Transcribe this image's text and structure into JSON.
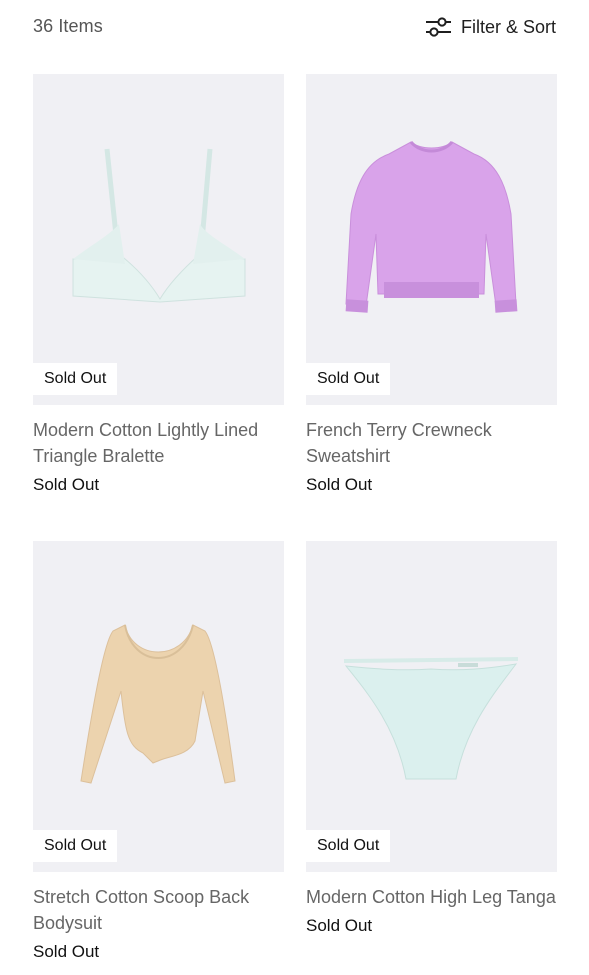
{
  "header": {
    "item_count": "36 Items",
    "filter_label": "Filter & Sort",
    "filter_icon": "sliders-icon"
  },
  "products": [
    {
      "title": "Modern Cotton Lightly Lined Triangle Bralette",
      "badge": "Sold Out",
      "status": "Sold Out",
      "color": "#e6f3f1"
    },
    {
      "title": "French Terry Crewneck Sweatshirt",
      "badge": "Sold Out",
      "status": "Sold Out",
      "color": "#d9a3ea"
    },
    {
      "title": "Stretch Cotton Scoop Back Bodysuit",
      "badge": "Sold Out",
      "status": "Sold Out",
      "color": "#ecd3ae"
    },
    {
      "title": "Modern Cotton High Leg Tanga",
      "badge": "Sold Out",
      "status": "Sold Out",
      "color": "#dbf0ee"
    }
  ]
}
